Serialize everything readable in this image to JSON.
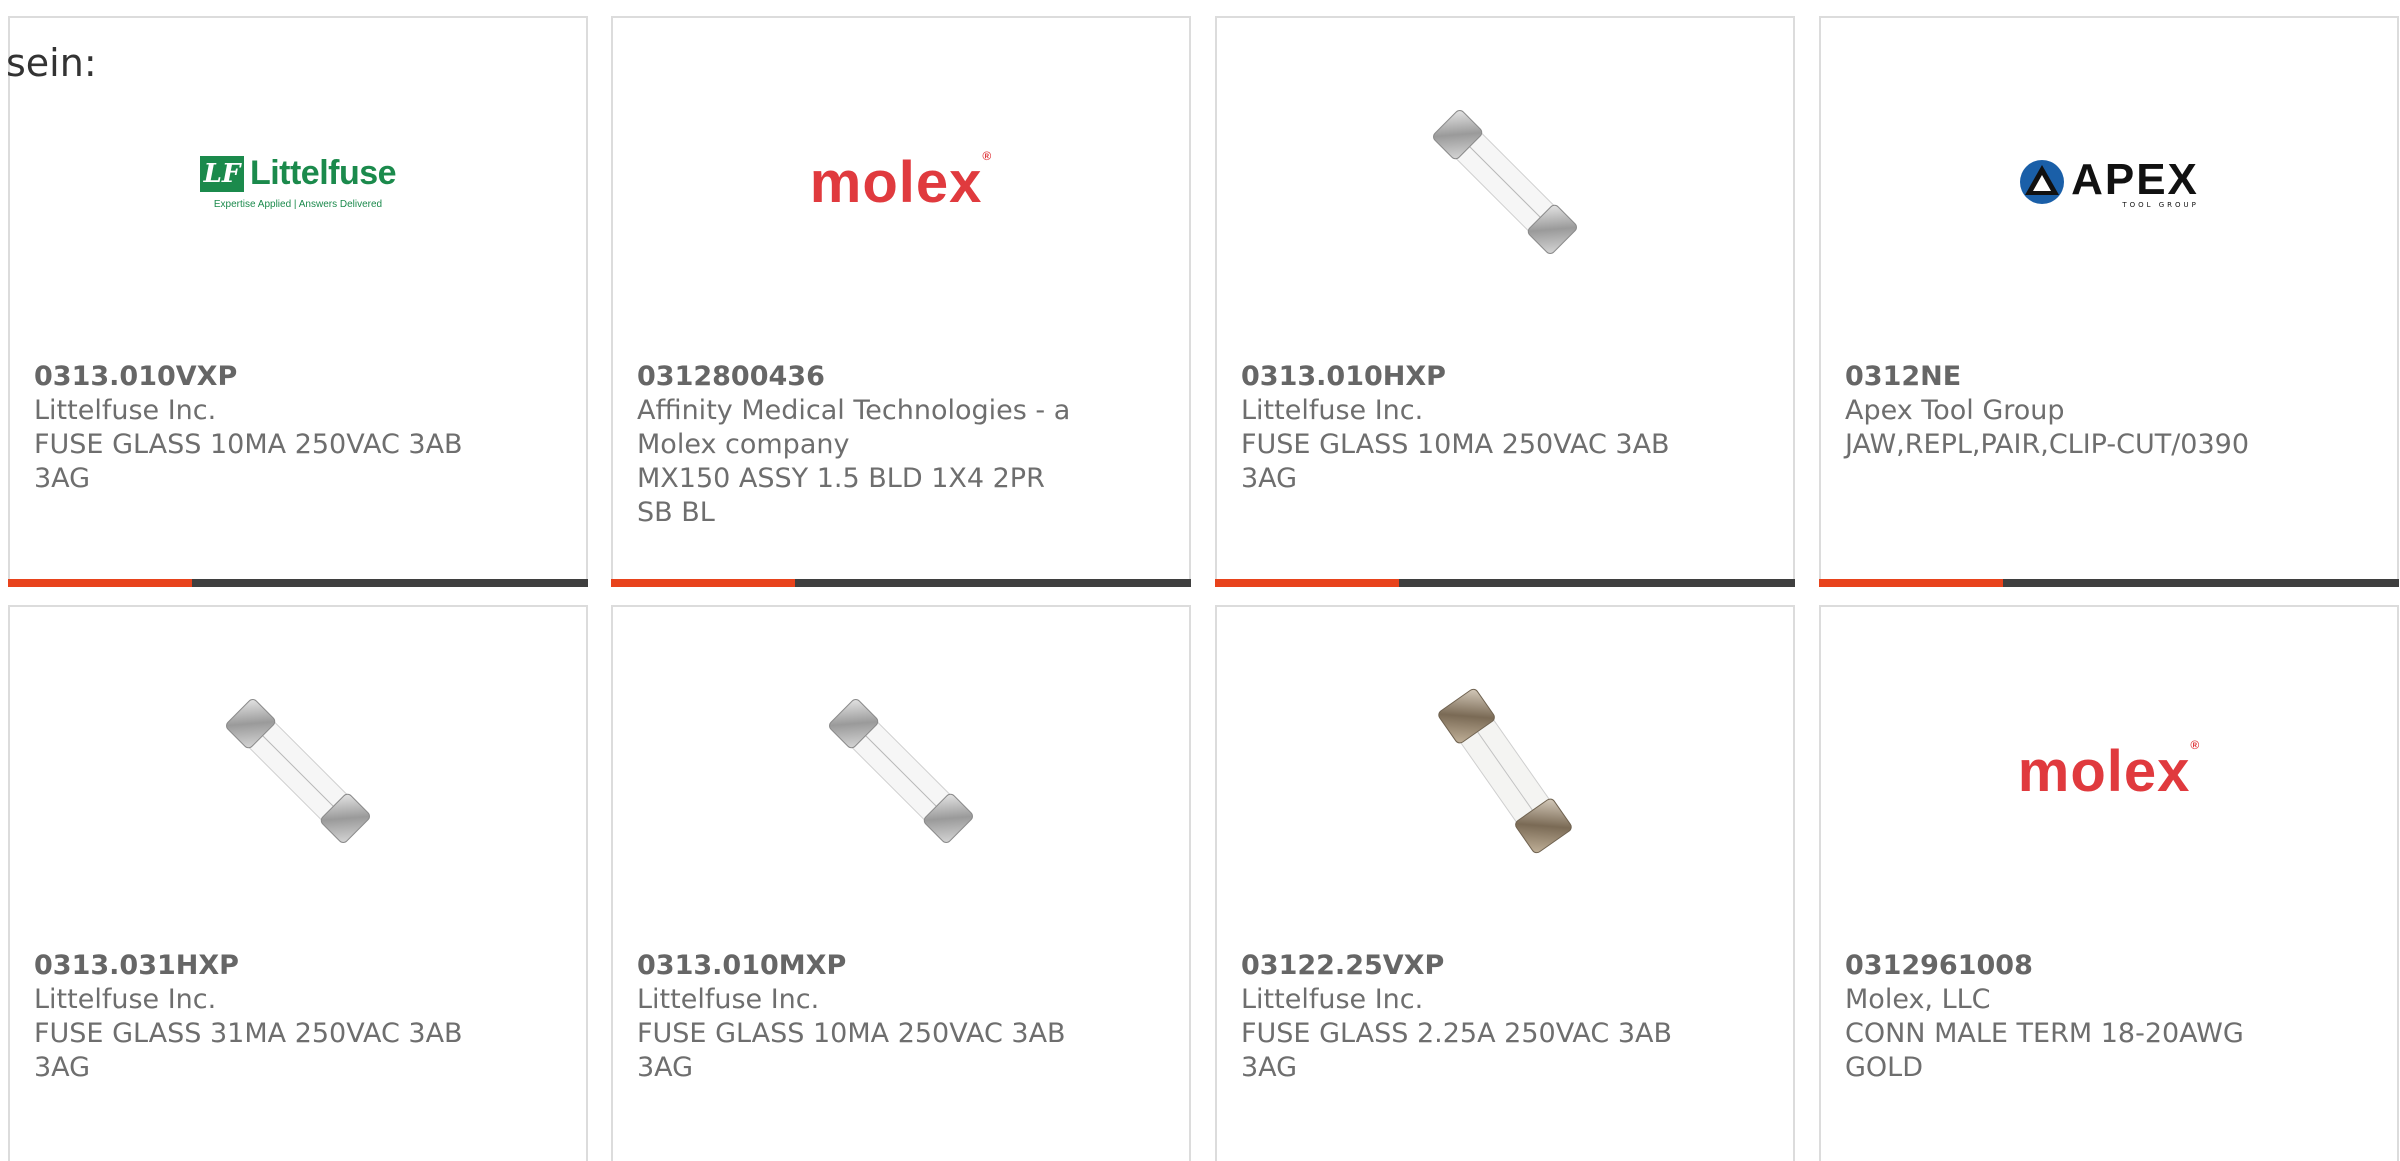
{
  "intro_text": "sein:",
  "products": [
    {
      "part_number": "0313.010VXP",
      "manufacturer": "Littelfuse Inc.",
      "description": "FUSE GLASS 10MA 250VAC 3AB 3AG",
      "image": "littelfuse-logo"
    },
    {
      "part_number": "0312800436",
      "manufacturer": "Affinity Medical Technologies - a Molex company",
      "description": "MX150 ASSY 1.5 BLD 1X4 2PR SB BL",
      "image": "molex-logo"
    },
    {
      "part_number": "0313.010HXP",
      "manufacturer": "Littelfuse Inc.",
      "description": "FUSE GLASS 10MA 250VAC 3AB 3AG",
      "image": "glass-fuse-photo"
    },
    {
      "part_number": "0312NE",
      "manufacturer": "Apex Tool Group",
      "description": "JAW,REPL,PAIR,CLIP-CUT/0390",
      "image": "apex-tool-group-logo"
    },
    {
      "part_number": "0313.031HXP",
      "manufacturer": "Littelfuse Inc.",
      "description": "FUSE GLASS 31MA 250VAC 3AB 3AG",
      "image": "glass-fuse-photo"
    },
    {
      "part_number": "0313.010MXP",
      "manufacturer": "Littelfuse Inc.",
      "description": "FUSE GLASS 10MA 250VAC 3AB 3AG",
      "image": "glass-fuse-photo"
    },
    {
      "part_number": "03122.25VXP",
      "manufacturer": "Littelfuse Inc.",
      "description": "FUSE GLASS 2.25A 250VAC 3AB 3AG",
      "image": "glass-fuse-brass-photo"
    },
    {
      "part_number": "0312961008",
      "manufacturer": "Molex, LLC",
      "description": "CONN MALE TERM 18-20AWG GOLD",
      "image": "molex-logo"
    }
  ],
  "logos": {
    "littelfuse": {
      "mark": "LF",
      "word": "Littelfuse",
      "tagline": "Expertise Applied | Answers Delivered"
    },
    "molex": {
      "word": "molex",
      "reg": "®"
    },
    "apex": {
      "word": "APEX",
      "sub": "TOOL GROUP"
    }
  },
  "colors": {
    "accent": "#e8431c",
    "bar": "#3f3f3f",
    "border": "#dcdcdc",
    "text": "#666666",
    "littelfuse_green": "#1b8a4c",
    "molex_red": "#e03a3e"
  }
}
